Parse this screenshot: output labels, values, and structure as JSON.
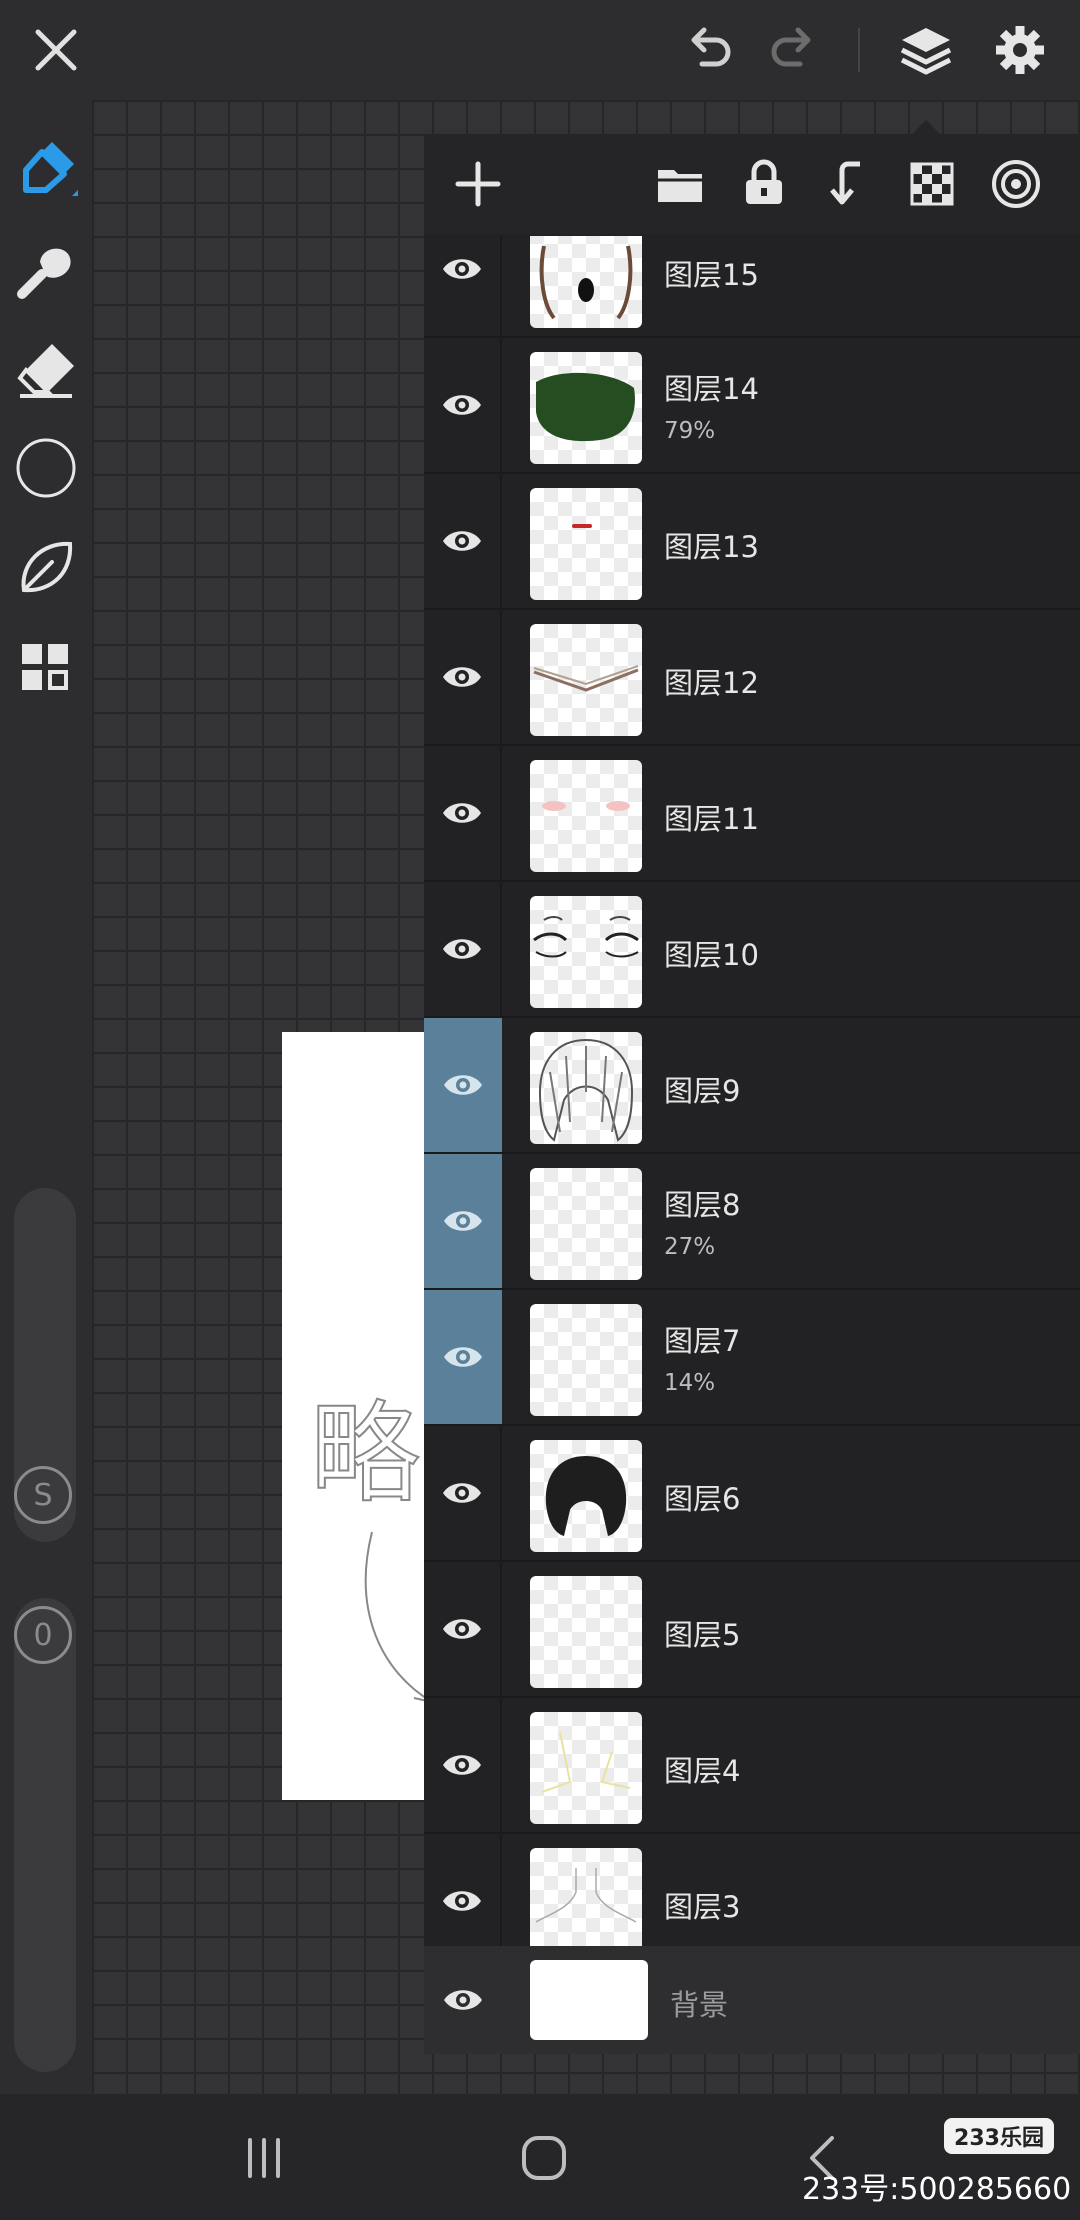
{
  "colors": {
    "accent_blue": "#2b9be8",
    "selected_row": "#5a8199",
    "panel_bg": "#222224"
  },
  "topbar": {
    "icons": [
      "close-icon",
      "undo-icon",
      "redo-icon",
      "layers-icon",
      "settings-icon"
    ]
  },
  "toolbar_left": {
    "tools": [
      "brush-tool-icon",
      "smudge-tool-icon",
      "eraser-tool-icon",
      "color-picker-icon",
      "leaf-brush-icon",
      "grid-menu-icon"
    ],
    "size_slider_label": "S",
    "opacity_slider_label": "0"
  },
  "layer_panel": {
    "toolbar_icons": [
      "add-layer-icon",
      "folder-icon",
      "lock-icon",
      "merge-down-icon",
      "transparency-icon",
      "blend-mode-icon"
    ],
    "layers": [
      {
        "name": "图层15",
        "opacity": "",
        "selected": false
      },
      {
        "name": "图层14",
        "opacity": "79%",
        "selected": false
      },
      {
        "name": "图层13",
        "opacity": "",
        "selected": false
      },
      {
        "name": "图层12",
        "opacity": "",
        "selected": false
      },
      {
        "name": "图层11",
        "opacity": "",
        "selected": false
      },
      {
        "name": "图层10",
        "opacity": "",
        "selected": false
      },
      {
        "name": "图层9",
        "opacity": "",
        "selected": true
      },
      {
        "name": "图层8",
        "opacity": "27%",
        "selected": true
      },
      {
        "name": "图层7",
        "opacity": "14%",
        "selected": true
      },
      {
        "name": "图层6",
        "opacity": "",
        "selected": false
      },
      {
        "name": "图层5",
        "opacity": "",
        "selected": false
      },
      {
        "name": "图层4",
        "opacity": "",
        "selected": false
      },
      {
        "name": "图层3",
        "opacity": "",
        "selected": false
      }
    ],
    "background_layer": "背景"
  },
  "canvas": {
    "sketch_text": "略"
  },
  "navbar": {
    "buttons": [
      "recent-apps-icon",
      "home-icon",
      "back-icon"
    ]
  },
  "watermark": {
    "logo": "233乐园",
    "id_text": "233号:500285660"
  }
}
